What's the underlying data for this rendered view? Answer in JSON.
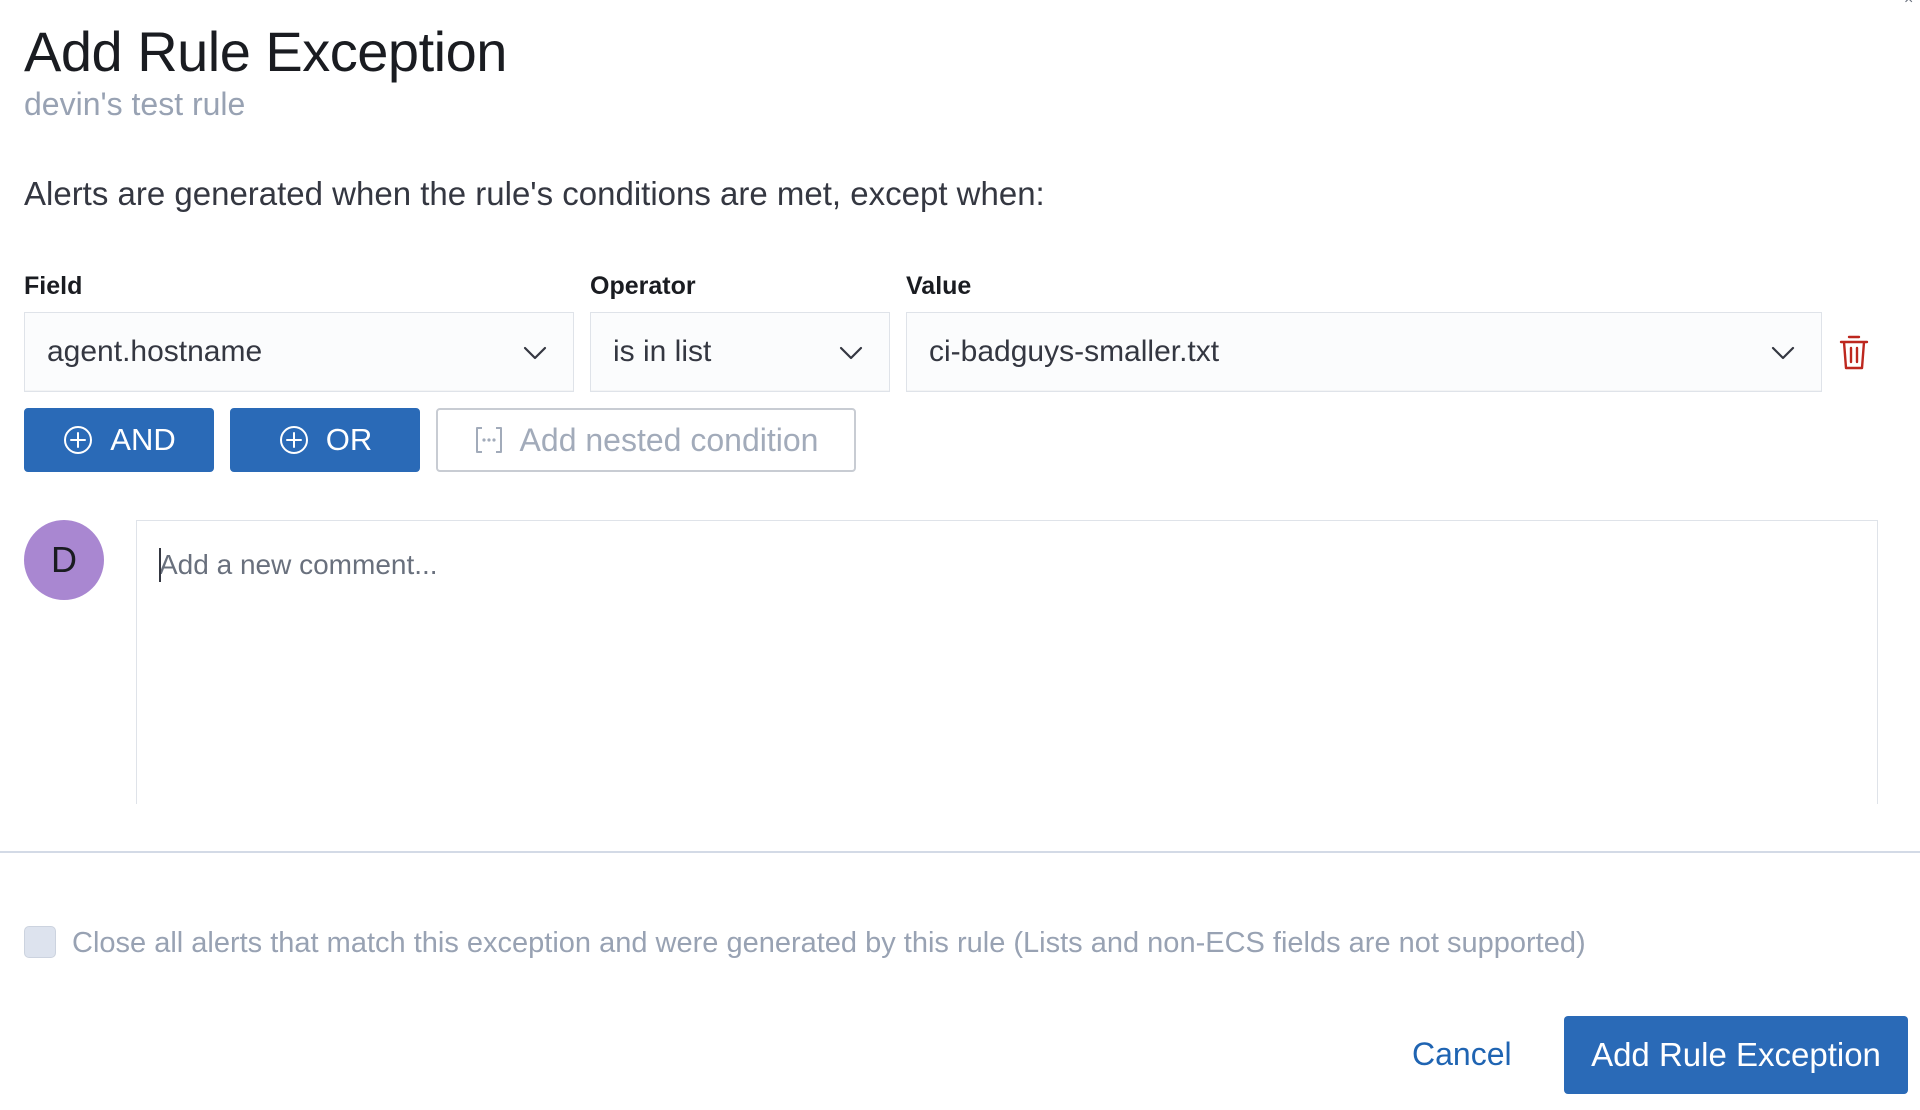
{
  "modal": {
    "close_glyph": "×",
    "title": "Add Rule Exception",
    "subtitle": "devin's test rule",
    "description": "Alerts are generated when the rule's conditions are met, except when:"
  },
  "entry": {
    "field_label": "Field",
    "operator_label": "Operator",
    "value_label": "Value",
    "field_value": "agent.hostname",
    "operator_value": "is in list",
    "value_value": "ci-badguys-smaller.txt",
    "delete_icon": "trash-icon"
  },
  "builder": {
    "and_label": "AND",
    "or_label": "OR",
    "nested_label": "Add nested condition"
  },
  "comment": {
    "avatar_initial": "D",
    "placeholder": "Add a new comment..."
  },
  "close_alerts": {
    "label": "Close all alerts that match this exception and were generated by this rule (Lists and non-ECS fields are not supported)",
    "checked": false
  },
  "footer": {
    "cancel_label": "Cancel",
    "submit_label": "Add Rule Exception"
  },
  "colors": {
    "primary": "#2a6ab7",
    "danger": "#bd271e",
    "avatar": "#a987d1",
    "subdued_text": "#98a2b3"
  }
}
